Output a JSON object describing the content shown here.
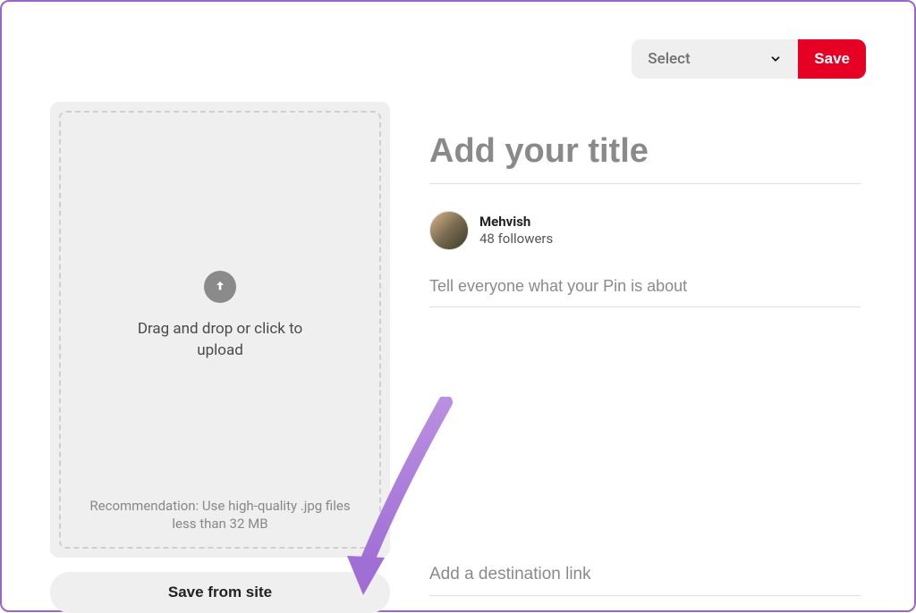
{
  "topbar": {
    "board_select_label": "Select",
    "save_label": "Save"
  },
  "upload": {
    "main_text": "Drag and drop or click to upload",
    "recommendation": "Recommendation: Use high-quality .jpg files less than 32 MB",
    "save_from_site_label": "Save from site"
  },
  "form": {
    "title_placeholder": "Add your title",
    "description_placeholder": "Tell everyone what your Pin is about",
    "destination_placeholder": "Add a destination link"
  },
  "user": {
    "name": "Mehvish",
    "followers_text": "48 followers"
  }
}
